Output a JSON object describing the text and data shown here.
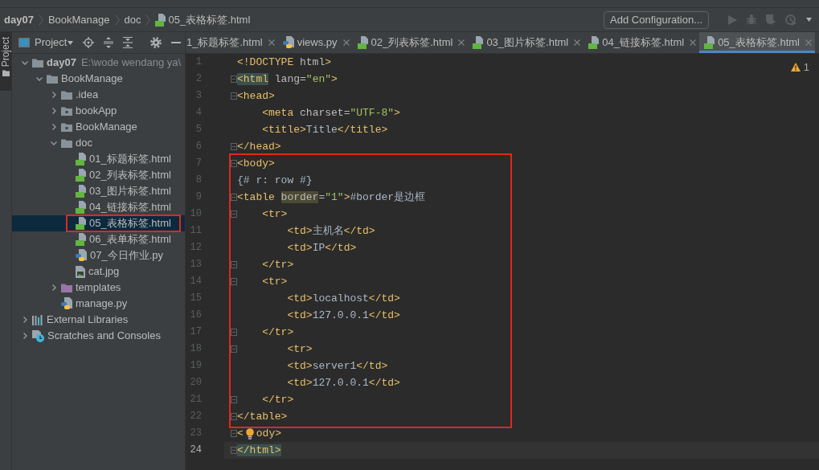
{
  "stripe": {
    "label": "Project",
    "selected": true
  },
  "breadcrumb": [
    {
      "label": "day07",
      "kind": "project"
    },
    {
      "label": "BookManage",
      "kind": "folder"
    },
    {
      "label": "doc",
      "kind": "folder"
    },
    {
      "label": "05_表格标签.html",
      "kind": "html"
    }
  ],
  "run_toolbar": {
    "config_button": "Add Configuration...",
    "actions": [
      {
        "kind": "run",
        "disabled": true
      },
      {
        "kind": "debug",
        "disabled": true
      },
      {
        "kind": "coverage",
        "disabled": true
      },
      {
        "kind": "profile",
        "disabled": true
      },
      {
        "kind": "more",
        "disabled": false
      }
    ]
  },
  "project_panel": {
    "title": "Project",
    "tools": [
      {
        "kind": "locate"
      },
      {
        "kind": "expand-all"
      },
      {
        "kind": "collapse-all"
      },
      {
        "kind": "settings"
      },
      {
        "kind": "hide"
      }
    ],
    "tree": [
      {
        "label": "day07",
        "kind": "project",
        "hint": "E:\\wode wendang ya\\",
        "expanded": true,
        "selected": false,
        "children": [
          {
            "label": "BookManage",
            "kind": "folder",
            "expanded": true,
            "selected": false,
            "children": [
              {
                "label": ".idea",
                "kind": "folder",
                "expanded": false,
                "selected": false
              },
              {
                "label": "bookApp",
                "kind": "module",
                "expanded": false,
                "selected": false
              },
              {
                "label": "BookManage",
                "kind": "module",
                "expanded": false,
                "selected": false
              },
              {
                "label": "doc",
                "kind": "folder",
                "expanded": true,
                "selected": false,
                "children": [
                  {
                    "label": "01_标题标签.html",
                    "kind": "html",
                    "selected": false
                  },
                  {
                    "label": "02_列表标签.html",
                    "kind": "html",
                    "selected": false
                  },
                  {
                    "label": "03_图片标签.html",
                    "kind": "html",
                    "selected": false
                  },
                  {
                    "label": "04_链接标签.html",
                    "kind": "html",
                    "selected": false
                  },
                  {
                    "label": "05_表格标签.html",
                    "kind": "html",
                    "selected": true,
                    "boxed": true
                  },
                  {
                    "label": "06_表单标签.html",
                    "kind": "html",
                    "selected": false
                  },
                  {
                    "label": "07_今日作业.py",
                    "kind": "python",
                    "selected": false
                  },
                  {
                    "label": "cat.jpg",
                    "kind": "image",
                    "selected": false
                  }
                ]
              },
              {
                "label": "templates",
                "kind": "templates",
                "expanded": false,
                "selected": false
              },
              {
                "label": "manage.py",
                "kind": "python",
                "selected": false
              }
            ]
          }
        ]
      },
      {
        "label": "External Libraries",
        "kind": "libraries",
        "expanded": false,
        "selected": false
      },
      {
        "label": "Scratches and Consoles",
        "kind": "scratches",
        "expanded": false,
        "selected": false
      }
    ]
  },
  "tabs": [
    {
      "label": "1_标题标签.html",
      "selected": false
    },
    {
      "label": "views.py",
      "kind": "python",
      "selected": false
    },
    {
      "label": "02_列表标签.html",
      "kind": "html",
      "selected": false
    },
    {
      "label": "03_图片标签.html",
      "kind": "html",
      "selected": false
    },
    {
      "label": "04_链接标签.html",
      "kind": "html",
      "selected": false
    },
    {
      "label": "05_表格标签.html",
      "kind": "html",
      "selected": true
    }
  ],
  "editor": {
    "problems": "1",
    "segments": [
      {
        "boxed": false,
        "lines": [
          {
            "number": "1",
            "fold": false,
            "current": false,
            "tokens": [
              {
                "kind": "tag",
                "text": "<!DOCTYPE"
              },
              {
                "kind": "attr",
                "text": " html"
              },
              {
                "kind": "tag",
                "text": ">"
              }
            ]
          },
          {
            "number": "2",
            "fold": true,
            "current": false,
            "tokens": [
              {
                "kind": "tag",
                "text": "<html",
                "highlighted": true
              },
              {
                "kind": "attr",
                "text": " lang="
              },
              {
                "kind": "value",
                "text": "\"en\""
              },
              {
                "kind": "tag",
                "text": ">"
              }
            ]
          },
          {
            "number": "3",
            "fold": true,
            "current": false,
            "tokens": [
              {
                "kind": "tag",
                "text": "<head>"
              }
            ]
          },
          {
            "number": "4",
            "fold": false,
            "current": false,
            "tokens": [
              {
                "kind": "tag",
                "text": "    <meta"
              },
              {
                "kind": "attr",
                "text": " charset="
              },
              {
                "kind": "value",
                "text": "\"UTF-8\""
              },
              {
                "kind": "tag",
                "text": ">"
              }
            ]
          },
          {
            "number": "5",
            "fold": false,
            "current": false,
            "tokens": [
              {
                "kind": "tag",
                "text": "    <title>"
              },
              {
                "kind": "text",
                "text": "Title"
              },
              {
                "kind": "tag",
                "text": "</title>"
              }
            ]
          },
          {
            "number": "6",
            "fold": true,
            "current": false,
            "tokens": [
              {
                "kind": "tag",
                "text": "</head>"
              }
            ]
          }
        ]
      },
      {
        "boxed": true,
        "lines": [
          {
            "number": "7",
            "fold": true,
            "current": false,
            "tokens": [
              {
                "kind": "tag",
                "text": "<body>"
              }
            ]
          },
          {
            "number": "8",
            "fold": false,
            "current": false,
            "tokens": [
              {
                "kind": "text",
                "text": "{# r: row #}"
              }
            ]
          },
          {
            "number": "9",
            "fold": true,
            "current": false,
            "tokens": [
              {
                "kind": "tag",
                "text": "<table "
              },
              {
                "kind": "attr",
                "text": "border",
                "highlighted": true
              },
              {
                "kind": "attr",
                "text": "="
              },
              {
                "kind": "value",
                "text": "\"1\""
              },
              {
                "kind": "tag",
                "text": ">"
              },
              {
                "kind": "text",
                "text": "#border是边框"
              }
            ]
          },
          {
            "number": "10",
            "fold": true,
            "current": false,
            "tokens": [
              {
                "kind": "tag",
                "text": "    <tr>"
              }
            ]
          },
          {
            "number": "11",
            "fold": false,
            "current": false,
            "tokens": [
              {
                "kind": "tag",
                "text": "        <td>"
              },
              {
                "kind": "text",
                "text": "主机名"
              },
              {
                "kind": "tag",
                "text": "</td>"
              }
            ]
          },
          {
            "number": "12",
            "fold": false,
            "current": false,
            "tokens": [
              {
                "kind": "tag",
                "text": "        <td>"
              },
              {
                "kind": "text",
                "text": "IP"
              },
              {
                "kind": "tag",
                "text": "</td>"
              }
            ]
          },
          {
            "number": "13",
            "fold": true,
            "current": false,
            "tokens": [
              {
                "kind": "tag",
                "text": "    </tr>"
              }
            ]
          },
          {
            "number": "14",
            "fold": true,
            "current": false,
            "tokens": [
              {
                "kind": "tag",
                "text": "    <tr>"
              }
            ]
          },
          {
            "number": "15",
            "fold": false,
            "current": false,
            "tokens": [
              {
                "kind": "tag",
                "text": "        <td>"
              },
              {
                "kind": "text",
                "text": "localhost"
              },
              {
                "kind": "tag",
                "text": "</td>"
              }
            ]
          },
          {
            "number": "16",
            "fold": false,
            "current": false,
            "tokens": [
              {
                "kind": "tag",
                "text": "        <td>"
              },
              {
                "kind": "text",
                "text": "127.0.0.1"
              },
              {
                "kind": "tag",
                "text": "</td>"
              }
            ]
          },
          {
            "number": "17",
            "fold": true,
            "current": false,
            "tokens": [
              {
                "kind": "tag",
                "text": "    </tr>"
              }
            ]
          },
          {
            "number": "18",
            "fold": true,
            "current": false,
            "tokens": [
              {
                "kind": "tag",
                "text": "        <tr>"
              }
            ]
          },
          {
            "number": "19",
            "fold": false,
            "current": false,
            "tokens": [
              {
                "kind": "tag",
                "text": "        <td>"
              },
              {
                "kind": "text",
                "text": "server1"
              },
              {
                "kind": "tag",
                "text": "</td>"
              }
            ]
          },
          {
            "number": "20",
            "fold": false,
            "current": false,
            "tokens": [
              {
                "kind": "tag",
                "text": "        <td>"
              },
              {
                "kind": "text",
                "text": "127.0.0.1"
              },
              {
                "kind": "tag",
                "text": "</td>"
              }
            ]
          },
          {
            "number": "21",
            "fold": true,
            "current": false,
            "tokens": [
              {
                "kind": "tag",
                "text": "    </tr>"
              }
            ]
          },
          {
            "number": "22",
            "fold": true,
            "current": false,
            "tokens": [
              {
                "kind": "tag",
                "text": "</table>"
              }
            ]
          }
        ]
      },
      {
        "boxed": false,
        "lines": [
          {
            "number": "23",
            "fold": true,
            "current": false,
            "tokens": [
              {
                "kind": "tag",
                "text": "<"
              },
              {
                "kind": "bulb"
              },
              {
                "kind": "tag",
                "text": "ody>"
              }
            ]
          },
          {
            "number": "24",
            "fold": true,
            "current": true,
            "tokens": [
              {
                "kind": "tag",
                "text": "</html>",
                "highlighted": true
              }
            ]
          }
        ]
      }
    ]
  }
}
